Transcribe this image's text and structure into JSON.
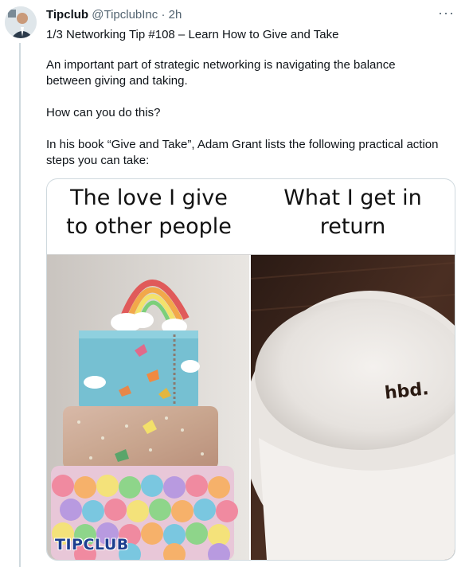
{
  "tweet": {
    "author_name": "Tipclub",
    "author_handle": "@TipclubInc",
    "separator": " · ",
    "time": "2h",
    "more": "···",
    "line1": "1/3  Networking Tip #108 – Learn How to Give and Take",
    "line2a": "An important part of strategic networking is navigating the balance",
    "line2b": "between giving and taking.",
    "line3": "How can you do this?",
    "line4a": "In his book “Give and Take”, Adam Grant lists the following practical action",
    "line4b": "steps you can take:"
  },
  "media": {
    "left_caption_1": "The love I give",
    "left_caption_2": "to other people",
    "right_caption_1": "What I get in",
    "right_caption_2": "return",
    "watermark": "TIPCLUB",
    "cake_text": "hbd."
  }
}
